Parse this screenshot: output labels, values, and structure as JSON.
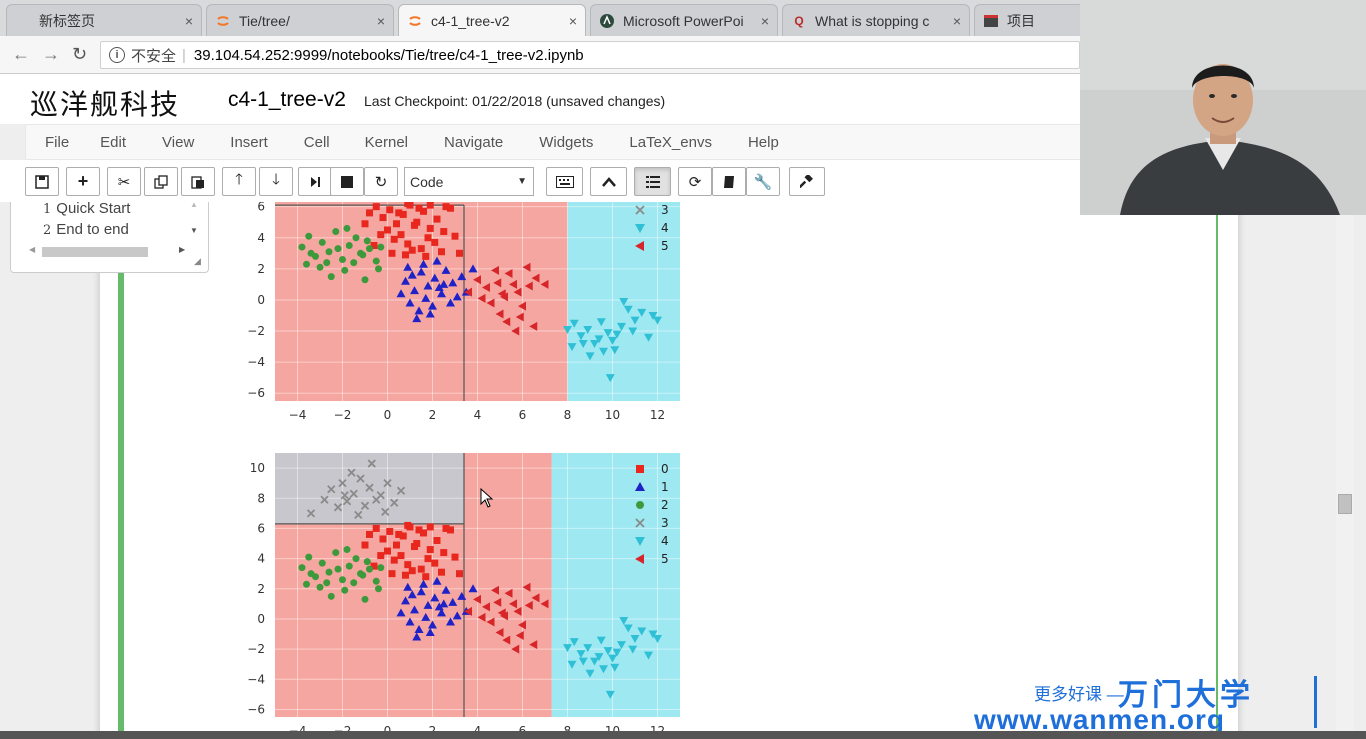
{
  "browser": {
    "tabs": [
      {
        "title": "新标签页",
        "icon": "blank-page-icon"
      },
      {
        "title": "Tie/tree/",
        "icon": "jupyter-icon"
      },
      {
        "title": "c4-1_tree-v2",
        "icon": "jupyter-icon"
      },
      {
        "title": "Microsoft PowerPoi",
        "icon": "powerpoint-icon"
      },
      {
        "title": "What is stopping c",
        "icon": "quora-icon"
      },
      {
        "title": "项目",
        "icon": "project-icon"
      }
    ],
    "close_glyph": "×",
    "security_label": "不安全",
    "url": "39.104.54.252:9999/notebooks/Tie/tree/c4-1_tree-v2.ipynb"
  },
  "notebook": {
    "logo_text": "巡洋舰科技",
    "name": "c4-1_tree-v2",
    "checkpoint": "Last Checkpoint: 01/22/2018 (unsaved changes)",
    "menu": [
      "File",
      "Edit",
      "View",
      "Insert",
      "Cell",
      "Kernel",
      "Navigate",
      "Widgets",
      "LaTeX_envs",
      "Help"
    ],
    "cell_type": "Code"
  },
  "toc": {
    "items": [
      {
        "num": "1",
        "label": "Quick Start"
      },
      {
        "num": "2",
        "label": "End to end"
      }
    ]
  },
  "watermark": {
    "slogan": "更多好课 —",
    "brand": "万门大学",
    "url": "www.wanmen.org"
  },
  "chart_data": [
    {
      "type": "scatter",
      "title": "",
      "xlabel": "",
      "ylabel": "",
      "xticks": [
        -4,
        -2,
        0,
        2,
        4,
        6,
        8,
        10,
        12
      ],
      "yticks": [
        -6,
        -4,
        -2,
        0,
        2,
        4,
        6
      ],
      "xlim": [
        -5,
        13
      ],
      "ylim": [
        -6.5,
        6.3
      ],
      "regions": [
        {
          "x": [
            -5,
            8
          ],
          "y": [
            -6.5,
            6.3
          ],
          "class": "0",
          "color": "#f6a6a0"
        },
        {
          "x": [
            8,
            13
          ],
          "y": [
            -6.5,
            6.3
          ],
          "class": "4",
          "color": "#9ee8f2"
        }
      ],
      "split_lines": [
        {
          "x": [
            3.4,
            3.4
          ],
          "y": [
            -6.5,
            6.1
          ]
        },
        {
          "x": [
            -5,
            3.4
          ],
          "y": [
            6.1,
            6.1
          ]
        }
      ],
      "legend_visible": [
        "3",
        "4",
        "5"
      ],
      "legend_position": "top-right"
    },
    {
      "type": "scatter",
      "title": "",
      "xlabel": "",
      "ylabel": "",
      "xticks": [
        -4,
        -2,
        0,
        2,
        4,
        6,
        8,
        10,
        12
      ],
      "yticks": [
        -6,
        -4,
        -2,
        0,
        2,
        4,
        6,
        8,
        10
      ],
      "xlim": [
        -5,
        13
      ],
      "ylim": [
        -6.5,
        11
      ],
      "regions": [
        {
          "x": [
            -5,
            3.4
          ],
          "y": [
            6.3,
            11
          ],
          "class": "3",
          "color": "#c7c7cd"
        },
        {
          "x": [
            -5,
            3.4
          ],
          "y": [
            -6.5,
            6.3
          ],
          "class": "0",
          "color": "#f6a6a0"
        },
        {
          "x": [
            3.4,
            7.3
          ],
          "y": [
            -6.5,
            11
          ],
          "class": "5",
          "color": "#f6a6a0"
        },
        {
          "x": [
            7.3,
            13
          ],
          "y": [
            -6.5,
            11
          ],
          "class": "4",
          "color": "#9ee8f2"
        }
      ],
      "split_lines": [
        {
          "x": [
            3.4,
            3.4
          ],
          "y": [
            -6.5,
            11
          ]
        },
        {
          "x": [
            -5,
            3.4
          ],
          "y": [
            6.3,
            6.3
          ]
        }
      ],
      "legend": [
        "0",
        "1",
        "2",
        "3",
        "4",
        "5"
      ],
      "legend_position": "top-right"
    }
  ],
  "class_styles": [
    {
      "label": "0",
      "color": "#e8281e",
      "marker": "square"
    },
    {
      "label": "1",
      "color": "#1f22c7",
      "marker": "triangle-up"
    },
    {
      "label": "2",
      "color": "#3c9a3c",
      "marker": "circle"
    },
    {
      "label": "3",
      "color": "#8a8a8a",
      "marker": "x"
    },
    {
      "label": "4",
      "color": "#2fc0d6",
      "marker": "triangle-down"
    },
    {
      "label": "5",
      "color": "#d7262a",
      "marker": "triangle-left"
    }
  ],
  "points": {
    "0": [
      [
        -0.8,
        5.6
      ],
      [
        -0.5,
        6.0
      ],
      [
        -0.2,
        5.3
      ],
      [
        0.1,
        5.8
      ],
      [
        0.4,
        4.9
      ],
      [
        0.7,
        5.5
      ],
      [
        1.0,
        6.1
      ],
      [
        1.3,
        5.0
      ],
      [
        1.6,
        5.7
      ],
      [
        1.9,
        4.6
      ],
      [
        2.2,
        5.2
      ],
      [
        2.5,
        4.4
      ],
      [
        0.0,
        4.5
      ],
      [
        0.3,
        3.9
      ],
      [
        0.6,
        4.2
      ],
      [
        0.9,
        3.6
      ],
      [
        1.2,
        4.8
      ],
      [
        1.5,
        3.3
      ],
      [
        1.8,
        4.0
      ],
      [
        2.1,
        3.7
      ],
      [
        -0.3,
        4.2
      ],
      [
        0.8,
        2.9
      ],
      [
        1.1,
        3.2
      ],
      [
        2.8,
        5.9
      ],
      [
        3.0,
        4.1
      ],
      [
        -1.0,
        4.9
      ],
      [
        1.4,
        5.9
      ],
      [
        0.5,
        5.6
      ],
      [
        2.6,
        6.0
      ],
      [
        3.2,
        3.0
      ],
      [
        -0.6,
        3.5
      ],
      [
        1.7,
        2.8
      ],
      [
        0.2,
        3.0
      ],
      [
        2.4,
        3.1
      ],
      [
        0.9,
        6.2
      ],
      [
        1.9,
        6.1
      ]
    ],
    "1": [
      [
        0.8,
        1.2
      ],
      [
        1.2,
        0.6
      ],
      [
        1.5,
        1.8
      ],
      [
        1.8,
        0.9
      ],
      [
        2.1,
        1.4
      ],
      [
        2.4,
        0.4
      ],
      [
        1.0,
        -0.2
      ],
      [
        1.4,
        -0.7
      ],
      [
        1.7,
        0.1
      ],
      [
        2.0,
        -0.4
      ],
      [
        2.3,
        0.8
      ],
      [
        2.6,
        1.9
      ],
      [
        2.9,
        1.1
      ],
      [
        3.1,
        0.2
      ],
      [
        1.6,
        2.3
      ],
      [
        2.2,
        2.5
      ],
      [
        0.6,
        0.4
      ],
      [
        1.1,
        1.6
      ],
      [
        2.8,
        -0.2
      ],
      [
        1.9,
        -0.9
      ],
      [
        3.3,
        1.5
      ],
      [
        2.5,
        1.0
      ],
      [
        1.3,
        -1.2
      ],
      [
        0.9,
        2.1
      ],
      [
        3.5,
        0.5
      ],
      [
        3.8,
        2.0
      ]
    ],
    "2": [
      [
        -3.8,
        3.4
      ],
      [
        -3.5,
        4.1
      ],
      [
        -3.2,
        2.8
      ],
      [
        -2.9,
        3.7
      ],
      [
        -2.6,
        3.1
      ],
      [
        -2.3,
        4.4
      ],
      [
        -2.0,
        2.6
      ],
      [
        -1.7,
        3.5
      ],
      [
        -1.4,
        4.0
      ],
      [
        -1.1,
        2.9
      ],
      [
        -0.8,
        3.3
      ],
      [
        -0.5,
        2.5
      ],
      [
        -3.0,
        2.1
      ],
      [
        -2.5,
        1.5
      ],
      [
        -1.9,
        1.9
      ],
      [
        -1.2,
        3.0
      ],
      [
        -0.4,
        2.0
      ],
      [
        -3.4,
        3.0
      ],
      [
        -2.7,
        2.4
      ],
      [
        -1.5,
        2.4
      ],
      [
        -0.9,
        3.8
      ],
      [
        -2.2,
        3.3
      ],
      [
        -1.0,
        1.3
      ],
      [
        -3.6,
        2.3
      ],
      [
        -0.3,
        3.4
      ],
      [
        -1.8,
        4.6
      ]
    ],
    "3": [
      [
        -2.5,
        8.6
      ],
      [
        -2.0,
        9.0
      ],
      [
        -1.8,
        7.8
      ],
      [
        -1.5,
        8.3
      ],
      [
        -1.2,
        9.3
      ],
      [
        -1.0,
        7.5
      ],
      [
        -0.8,
        8.7
      ],
      [
        -0.5,
        7.9
      ],
      [
        -2.2,
        7.4
      ],
      [
        -1.6,
        9.7
      ],
      [
        -0.3,
        8.2
      ],
      [
        0.0,
        9.0
      ],
      [
        0.3,
        7.7
      ],
      [
        0.6,
        8.5
      ],
      [
        -2.8,
        7.9
      ],
      [
        -1.3,
        6.9
      ],
      [
        -0.7,
        10.3
      ],
      [
        -1.9,
        8.2
      ],
      [
        -3.4,
        7.0
      ],
      [
        -0.1,
        7.1
      ]
    ],
    "4": [
      [
        8.3,
        -1.5
      ],
      [
        8.6,
        -2.3
      ],
      [
        8.9,
        -1.9
      ],
      [
        9.2,
        -2.8
      ],
      [
        9.5,
        -1.4
      ],
      [
        9.8,
        -2.1
      ],
      [
        10.1,
        -3.2
      ],
      [
        10.4,
        -1.7
      ],
      [
        10.7,
        -0.6
      ],
      [
        11.0,
        -1.3
      ],
      [
        11.3,
        -0.8
      ],
      [
        8.2,
        -3.0
      ],
      [
        9.0,
        -3.6
      ],
      [
        9.4,
        -2.5
      ],
      [
        10.2,
        -2.2
      ],
      [
        10.9,
        -2.0
      ],
      [
        11.6,
        -2.4
      ],
      [
        8.7,
        -2.8
      ],
      [
        9.9,
        -5.0
      ],
      [
        10.5,
        -0.1
      ],
      [
        11.8,
        -1.0
      ],
      [
        9.6,
        -3.3
      ],
      [
        8.0,
        -1.9
      ],
      [
        10.0,
        -2.6
      ],
      [
        12.0,
        -1.3
      ]
    ],
    "5": [
      [
        4.0,
        1.3
      ],
      [
        4.4,
        0.8
      ],
      [
        4.8,
        1.9
      ],
      [
        5.2,
        0.2
      ],
      [
        5.6,
        1.0
      ],
      [
        6.0,
        -0.4
      ],
      [
        6.3,
        0.9
      ],
      [
        5.0,
        -0.9
      ],
      [
        5.4,
        1.7
      ],
      [
        5.8,
        0.5
      ],
      [
        6.2,
        2.1
      ],
      [
        6.6,
        1.4
      ],
      [
        4.6,
        -0.2
      ],
      [
        5.3,
        -1.4
      ],
      [
        5.9,
        -1.1
      ],
      [
        6.5,
        -1.7
      ],
      [
        4.2,
        0.1
      ],
      [
        7.0,
        1.0
      ],
      [
        5.7,
        -2.0
      ],
      [
        4.9,
        1.1
      ],
      [
        3.6,
        0.5
      ],
      [
        5.1,
        0.4
      ]
    ]
  }
}
